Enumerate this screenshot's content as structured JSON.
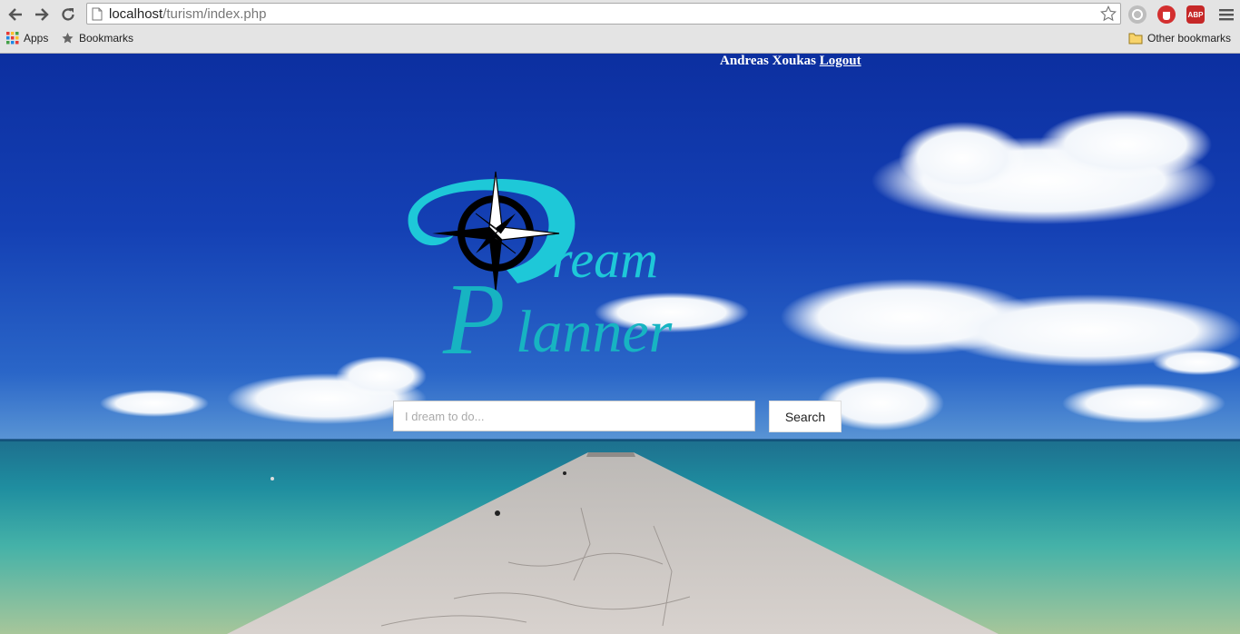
{
  "browser": {
    "url_host": "localhost",
    "url_path": "/turism/index.php",
    "bookmarks_bar": {
      "apps_label": "Apps",
      "bookmarks_label": "Bookmarks",
      "other_bookmarks_label": "Other bookmarks"
    },
    "extensions": [
      {
        "name": "gray-extension-icon",
        "color": "#9e9e9e"
      },
      {
        "name": "stop-extension-icon",
        "color": "#d32f2f"
      },
      {
        "name": "adblock-plus-icon",
        "label": "ABP",
        "color": "#c62828"
      }
    ]
  },
  "header": {
    "user_name": "Andreas Xoukas",
    "logout_label": "Logout"
  },
  "logo": {
    "word1": "ream",
    "word2": "lanner",
    "initial1": "D",
    "initial2": "P",
    "color": "#1ec8d8"
  },
  "search": {
    "placeholder": "I dream to do...",
    "value": "",
    "button_label": "Search"
  }
}
